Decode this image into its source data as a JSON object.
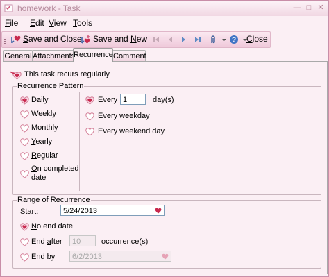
{
  "window": {
    "title": "homework - Task"
  },
  "colors": {
    "heart": "#c93a5a",
    "heart_outline": "#d7889f",
    "accent": "#e7bfd1"
  },
  "menu": [
    {
      "label": "File",
      "key": "F",
      "rest": "ile"
    },
    {
      "label": "Edit",
      "key": "E",
      "rest": "dit"
    },
    {
      "label": "View",
      "key": "V",
      "rest": "iew"
    },
    {
      "label": "Tools",
      "key": "T",
      "rest": "ools"
    }
  ],
  "toolbar": {
    "save_close": {
      "key": "S",
      "rest": "ave and Close"
    },
    "save_new": {
      "pre": "Save and ",
      "key": "N",
      "rest": "ew"
    },
    "close": {
      "key": "C",
      "rest": "lose"
    },
    "icons": [
      "save-close-icon",
      "save-new-icon",
      "first-icon",
      "previous-icon",
      "next-icon",
      "last-icon",
      "attach-icon",
      "help-icon",
      "dropdown-icon"
    ]
  },
  "tabs": [
    "General",
    "Attachments",
    "Recurrence",
    "Comment"
  ],
  "recurs": {
    "label": "This task recurs regularly",
    "checked": true
  },
  "pattern": {
    "title": "Recurrence Pattern",
    "options": [
      {
        "label": "Daily",
        "key": "D",
        "rest": "aily",
        "checked": true
      },
      {
        "label": "Weekly",
        "key": "W",
        "rest": "eekly",
        "checked": false
      },
      {
        "label": "Monthly",
        "key": "M",
        "rest": "onthly",
        "checked": false
      },
      {
        "label": "Yearly",
        "key": "Y",
        "rest": "early",
        "checked": false
      },
      {
        "label": "Regular",
        "key": "R",
        "rest": "egular",
        "checked": false
      },
      {
        "label_line1": "On completed",
        "key": "O",
        "rest": "n completed",
        "label_line2": "date",
        "checked": false
      }
    ],
    "every": {
      "label": "Every",
      "value": "1",
      "unit": "day(s)",
      "checked": true
    },
    "every_weekday": {
      "label": "Every weekday",
      "checked": false
    },
    "every_weekend": {
      "label": "Every weekend day",
      "checked": false
    }
  },
  "range": {
    "title": "Range of Recurrence",
    "start": {
      "key": "S",
      "rest": "tart:",
      "value": "5/24/2013"
    },
    "no_end": {
      "key": "N",
      "rest": "o end date",
      "checked": true
    },
    "end_after": {
      "pre": "End ",
      "key": "a",
      "rest": "fter",
      "value": "10",
      "unit": "occurrence(s)",
      "checked": false
    },
    "end_by": {
      "pre": "End ",
      "key": "b",
      "rest": "y",
      "value": "6/2/2013",
      "checked": false
    }
  }
}
